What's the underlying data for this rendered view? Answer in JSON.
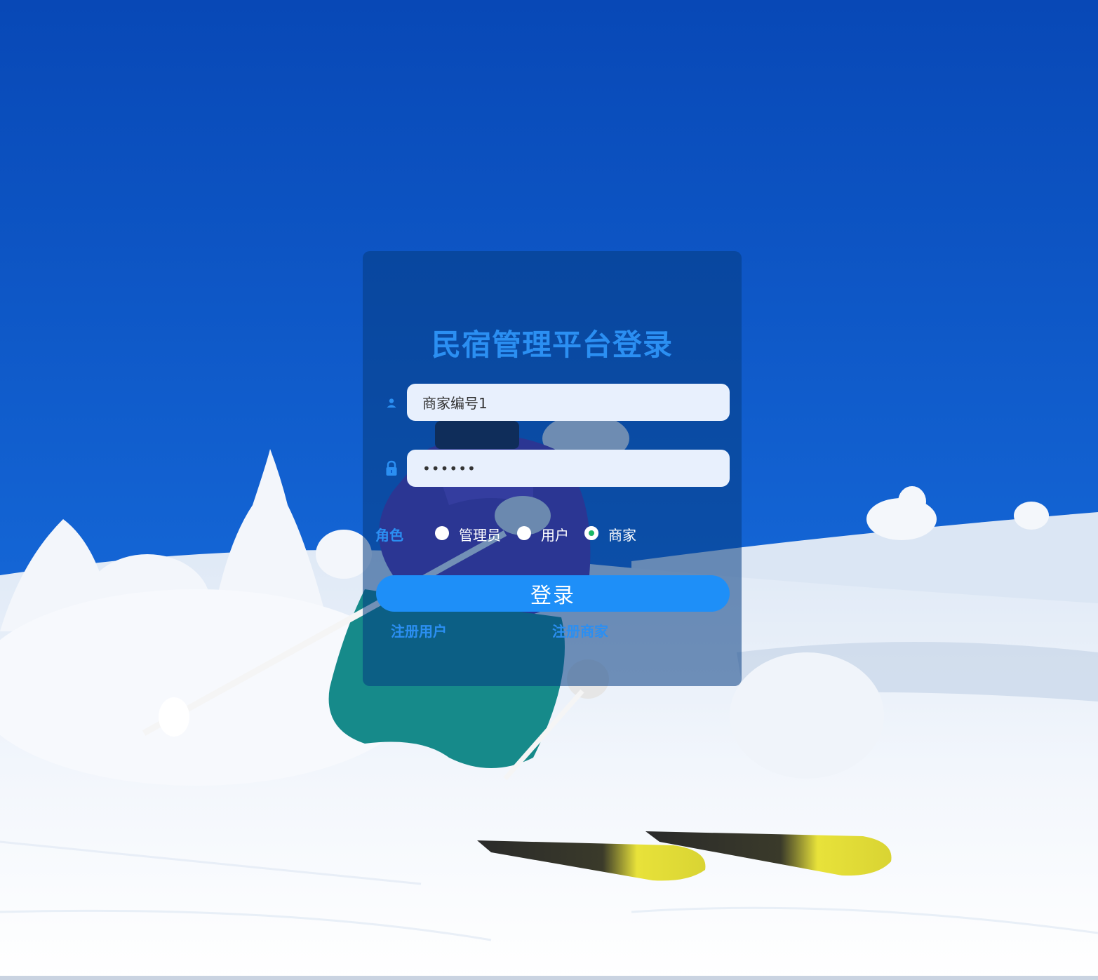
{
  "login": {
    "title": "民宿管理平台登录",
    "username": {
      "value": "商家编号1",
      "icon": "user-icon"
    },
    "password": {
      "value": "••••••",
      "icon": "lock-icon"
    },
    "role": {
      "label": "角色",
      "options": [
        "管理员",
        "用户",
        "商家"
      ],
      "selected": "商家"
    },
    "submit_label": "登录",
    "register_user": "注册用户",
    "register_merchant": "注册商家"
  },
  "colors": {
    "accent": "#2b8ff2",
    "button": "#1e8ff8",
    "radio_checked": "#19b865",
    "input_bg": "#e8f0fd"
  }
}
